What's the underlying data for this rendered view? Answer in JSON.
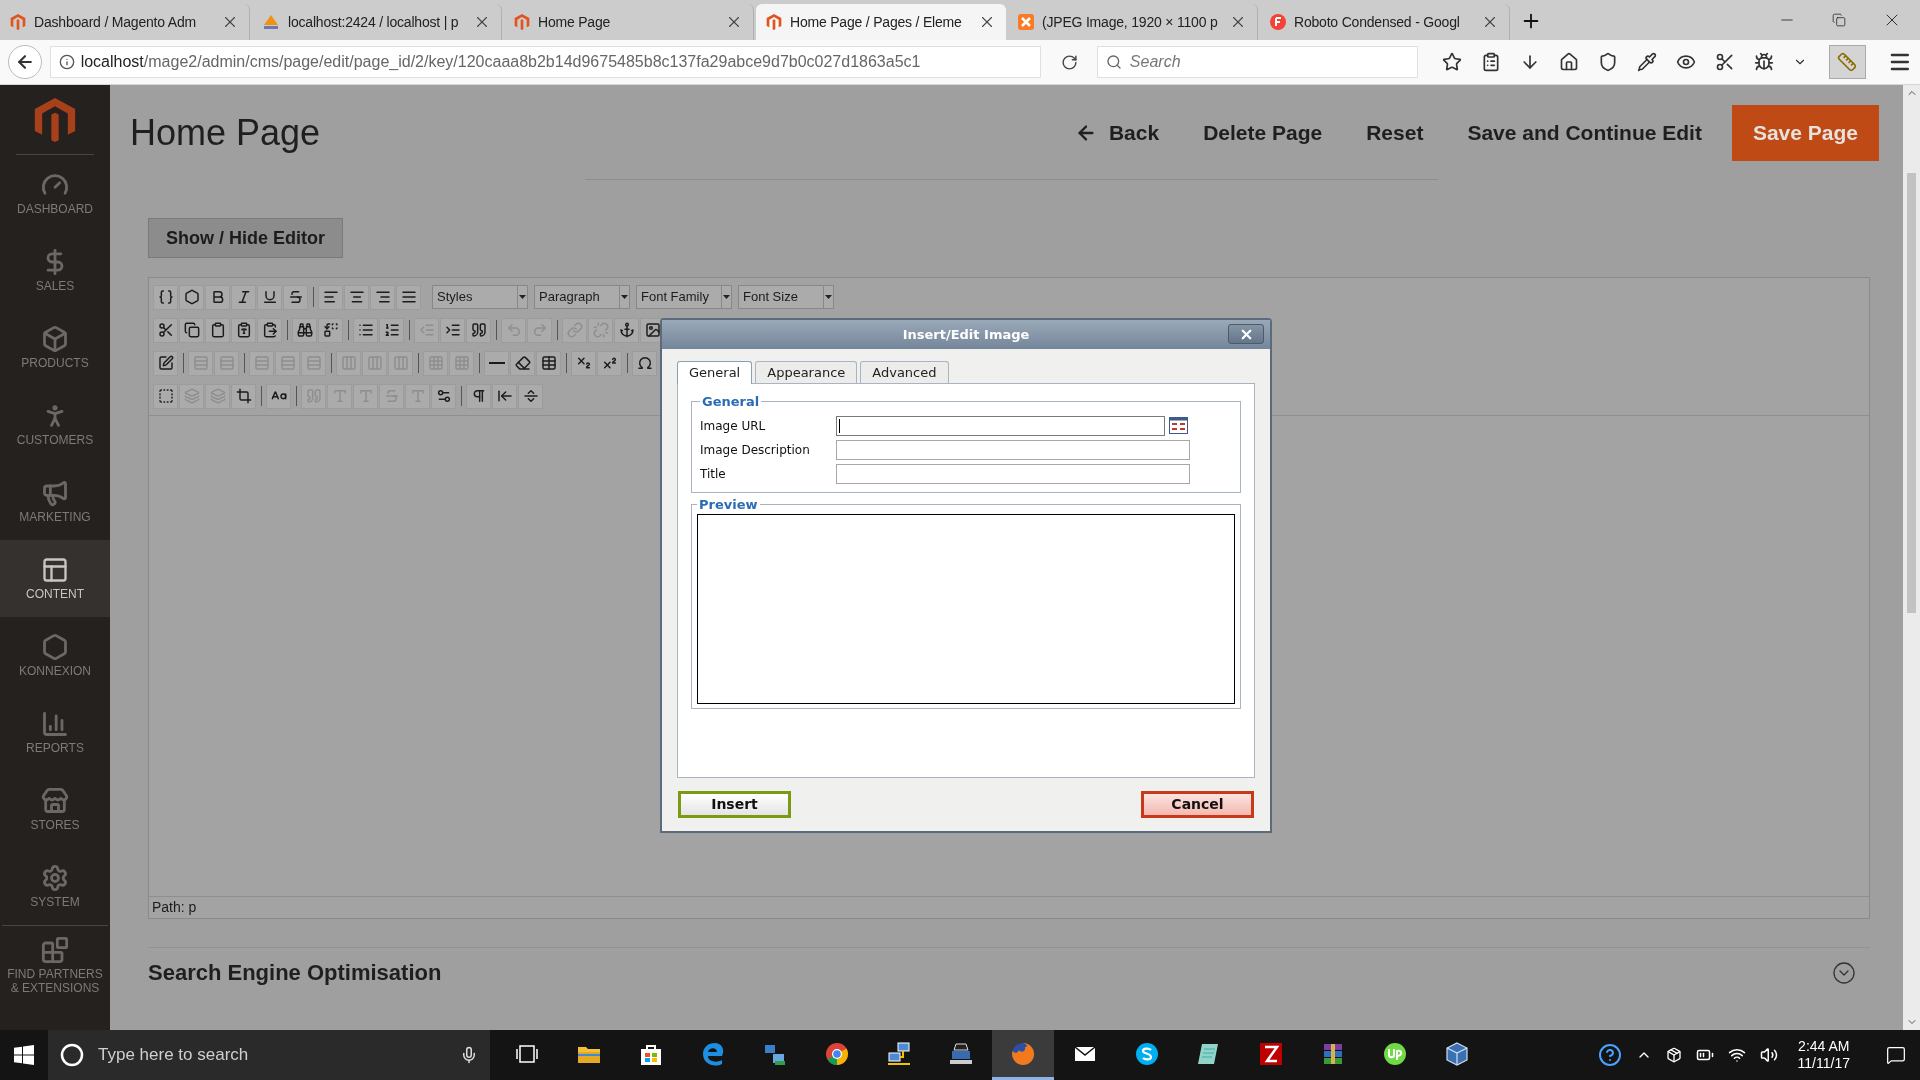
{
  "browser": {
    "tabs": [
      {
        "title": "Dashboard / Magento Adm",
        "kind": "magento",
        "selected": false
      },
      {
        "title": "localhost:2424 / localhost | p",
        "kind": "pma",
        "selected": false
      },
      {
        "title": "Home Page",
        "kind": "magento",
        "selected": false
      },
      {
        "title": "Home Page / Pages / Eleme",
        "kind": "magento",
        "selected": true
      },
      {
        "title": "(JPEG Image, 1920 × 1100 p",
        "kind": "xampp",
        "selected": false
      },
      {
        "title": "Roboto Condensed - Googl",
        "kind": "fonts",
        "selected": false
      }
    ],
    "url": {
      "host": "localhost",
      "path": "/mage2/admin/cms/page/edit/page_id/2/key/120caaa8b2b14d9675485b8c137fa29abce9d7b0c027d1863a5c1"
    },
    "search": {
      "placeholder": "Search"
    }
  },
  "sidebar": {
    "items": [
      {
        "label": "DASHBOARD",
        "selected": false
      },
      {
        "label": "SALES",
        "selected": false
      },
      {
        "label": "PRODUCTS",
        "selected": false
      },
      {
        "label": "CUSTOMERS",
        "selected": false
      },
      {
        "label": "MARKETING",
        "selected": false
      },
      {
        "label": "CONTENT",
        "selected": true
      },
      {
        "label": "KONNEXION",
        "selected": false
      },
      {
        "label": "REPORTS",
        "selected": false
      },
      {
        "label": "STORES",
        "selected": false
      },
      {
        "label": "SYSTEM",
        "selected": false
      },
      {
        "label": "FIND PARTNERS & EXTENSIONS",
        "selected": false
      }
    ]
  },
  "header": {
    "title": "Home Page",
    "buttons": [
      {
        "label": "Back",
        "kind": "back"
      },
      {
        "label": "Delete Page",
        "kind": "plain"
      },
      {
        "label": "Reset",
        "kind": "plain"
      },
      {
        "label": "Save and Continue Edit",
        "kind": "plain"
      },
      {
        "label": "Save Page",
        "kind": "primary"
      }
    ]
  },
  "editor_toggle": "Show / Hide Editor",
  "editor": {
    "toolbar": [
      [
        [
          {
            "disabled": false
          },
          {
            "disabled": false
          },
          {
            "disabled": false
          },
          {
            "disabled": false
          },
          {
            "disabled": false
          },
          {
            "disabled": false
          }
        ],
        [
          {
            "disabled": false
          },
          {
            "disabled": false
          },
          {
            "disabled": false
          },
          {
            "disabled": false
          }
        ]
      ],
      [
        [
          {
            "disabled": false
          },
          {
            "disabled": false
          },
          {
            "disabled": false
          },
          {
            "disabled": false
          },
          {
            "disabled": false
          }
        ],
        [
          {
            "disabled": false
          },
          {
            "disabled": false
          }
        ],
        [
          {
            "disabled": false
          },
          {
            "disabled": false
          }
        ],
        [
          {
            "disabled": true
          },
          {
            "disabled": false
          },
          {
            "disabled": false
          }
        ],
        [
          {
            "disabled": true
          },
          {
            "disabled": true
          }
        ],
        [
          {
            "disabled": true
          },
          {
            "disabled": true
          },
          {
            "disabled": false
          },
          {
            "disabled": false
          }
        ]
      ],
      [
        [
          {
            "disabled": false
          }
        ],
        [
          {
            "disabled": true
          },
          {
            "disabled": true
          }
        ],
        [
          {
            "disabled": true
          },
          {
            "disabled": true
          },
          {
            "disabled": true
          }
        ],
        [
          {
            "disabled": true
          },
          {
            "disabled": true
          },
          {
            "disabled": true
          }
        ],
        [
          {
            "disabled": true
          },
          {
            "disabled": true
          }
        ],
        [
          {
            "disabled": false
          },
          {
            "disabled": false
          },
          {
            "disabled": false
          }
        ],
        [
          {
            "disabled": false
          },
          {
            "disabled": false
          }
        ],
        [
          {
            "disabled": false
          }
        ]
      ],
      [
        [
          {
            "disabled": false
          },
          {
            "disabled": true
          },
          {
            "disabled": true
          },
          {
            "disabled": false
          }
        ],
        [
          {
            "disabled": false
          }
        ],
        [
          {
            "disabled": true
          },
          {
            "disabled": true
          },
          {
            "disabled": true
          },
          {
            "disabled": true
          },
          {
            "disabled": true
          },
          {
            "disabled": false
          }
        ],
        [
          {
            "disabled": false
          },
          {
            "disabled": false
          },
          {
            "disabled": false
          }
        ]
      ]
    ],
    "dropdowns": [
      "Styles",
      "Paragraph",
      "Font Family",
      "Font Size"
    ],
    "path": "Path: p"
  },
  "sections": [
    {
      "title": "Search Engine Optimisation",
      "expanded": false
    }
  ],
  "dialog": {
    "title": "Insert/Edit Image",
    "tabs": [
      {
        "label": "General",
        "selected": true
      },
      {
        "label": "Appearance",
        "selected": false
      },
      {
        "label": "Advanced",
        "selected": false
      }
    ],
    "general": {
      "legend": "General",
      "fields": [
        {
          "label": "Image URL",
          "kind": "browse",
          "focused": true
        },
        {
          "label": "Image Description",
          "kind": "text",
          "focused": false
        },
        {
          "label": "Title",
          "kind": "text",
          "focused": false
        }
      ]
    },
    "preview": {
      "legend": "Preview"
    },
    "buttons": [
      {
        "label": "Insert",
        "kind": "confirm"
      },
      {
        "label": "Cancel",
        "kind": "cancel"
      }
    ]
  },
  "taskbar": {
    "search": {
      "placeholder": "Type here to search"
    },
    "apps": [
      {
        "kind": "taskview",
        "selected": false
      },
      {
        "kind": "explorer",
        "selected": false
      },
      {
        "kind": "store",
        "selected": false
      },
      {
        "kind": "edge",
        "selected": false
      },
      {
        "kind": "network",
        "selected": false
      },
      {
        "kind": "chrome",
        "selected": false
      },
      {
        "kind": "remote",
        "selected": false
      },
      {
        "kind": "terminal",
        "selected": false
      },
      {
        "kind": "firefox",
        "selected": true
      },
      {
        "kind": "mail",
        "selected": false
      },
      {
        "kind": "skype",
        "selected": false
      },
      {
        "kind": "notes",
        "selected": false
      },
      {
        "kind": "filezilla",
        "selected": false
      },
      {
        "kind": "winrar",
        "selected": false
      },
      {
        "kind": "upwork",
        "selected": false
      },
      {
        "kind": "virtualbox",
        "selected": false
      }
    ],
    "time": "2:44 AM",
    "date": "11/11/17"
  }
}
